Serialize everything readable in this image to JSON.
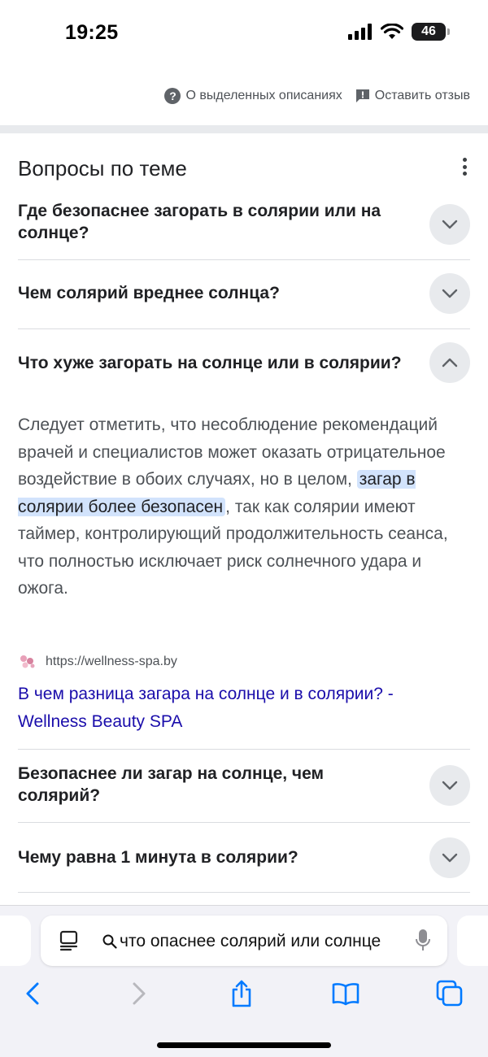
{
  "status_bar": {
    "time": "19:25",
    "battery": "46"
  },
  "feedback": {
    "about_label": "О выделенных описаниях",
    "feedback_label": "Оставить отзыв"
  },
  "paa": {
    "title": "Вопросы по теме",
    "questions": [
      {
        "text": "Где безопаснее загорать в солярии или на солнце?",
        "expanded": false
      },
      {
        "text": "Чем солярий вреднее солнца?",
        "expanded": false
      },
      {
        "text": "Что хуже загорать на солнце или в солярии?",
        "expanded": true
      },
      {
        "text": "Безопаснее ли загар на солнце, чем солярий?",
        "expanded": false
      },
      {
        "text": "Чему равна 1 минута в солярии?",
        "expanded": false
      }
    ],
    "answer": {
      "before": "Следует отметить, что несоблюдение рекомендаций врачей и специалистов может оказать отрицательное воздействие в обоих случаях, но в целом, ",
      "highlight": "загар в солярии более безопасен",
      "after": ", так как солярии имеют таймер, контролирующий продолжительность сеанса, что полностью исключает риск солнечного удара и ожога."
    },
    "source": {
      "url": "https://wellness-spa.by",
      "link_title": "В чем разница загара на солнце и в солярии? - Wellness Beauty SPA"
    }
  },
  "browser": {
    "search_query": "что опаснее солярий или солнце",
    "buttons": [
      "back",
      "forward",
      "share",
      "bookmarks",
      "tabs"
    ]
  },
  "colors": {
    "link": "#1a0dab",
    "highlight": "#d2e3fc",
    "chevron_bg": "#e8eaed",
    "safari_blue": "#007aff"
  }
}
